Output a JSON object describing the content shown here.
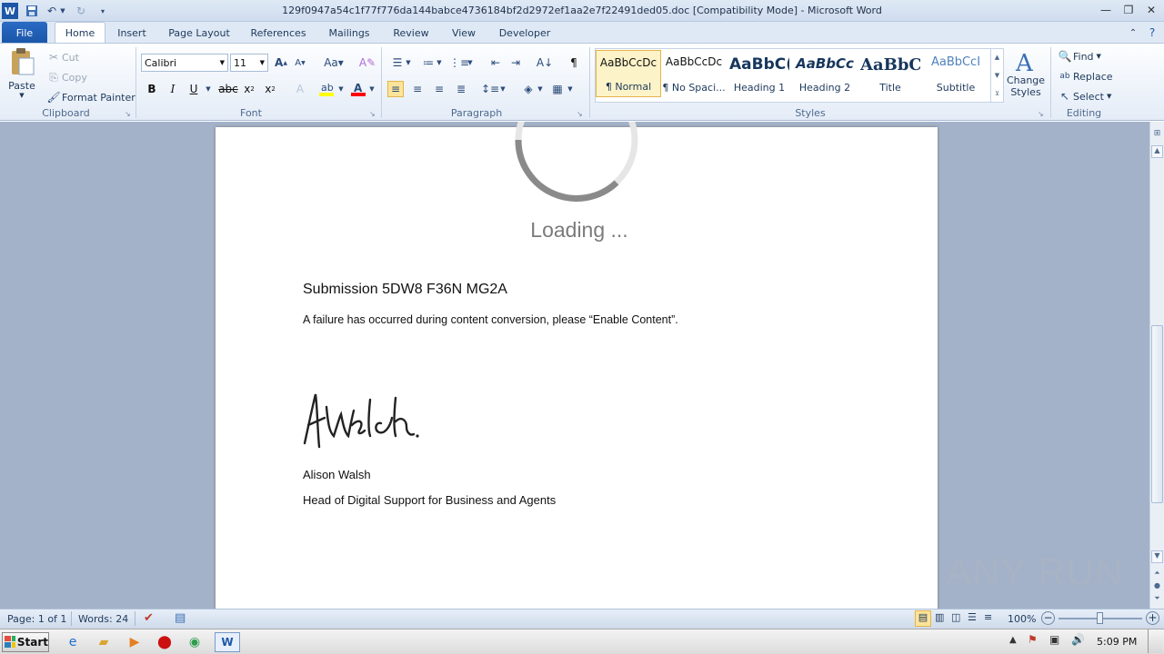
{
  "window": {
    "title": "129f0947a54c1f77f776da144babce4736184bf2d2972ef1aa2e7f22491ded05.doc [Compatibility Mode]  -  Microsoft Word"
  },
  "tabs": [
    "File",
    "Home",
    "Insert",
    "Page Layout",
    "References",
    "Mailings",
    "Review",
    "View",
    "Developer"
  ],
  "clipboard": {
    "paste": "Paste",
    "cut": "Cut",
    "copy": "Copy",
    "format_painter": "Format Painter",
    "label": "Clipboard"
  },
  "font": {
    "name": "Calibri",
    "size": "11",
    "label": "Font"
  },
  "paragraph": {
    "label": "Paragraph"
  },
  "styles": {
    "items": [
      {
        "preview": "AaBbCcDc",
        "label": "¶ Normal"
      },
      {
        "preview": "AaBbCcDc",
        "label": "¶ No Spaci..."
      },
      {
        "preview": "AaBbC(",
        "label": "Heading 1"
      },
      {
        "preview": "AaBbCc",
        "label": "Heading 2"
      },
      {
        "preview": "AaBbC(",
        "label": "Title"
      },
      {
        "preview": "AaBbCcI",
        "label": "Subtitle"
      }
    ],
    "change_styles": "Change Styles",
    "label": "Styles"
  },
  "editing": {
    "find": "Find",
    "replace": "Replace",
    "select": "Select",
    "label": "Editing"
  },
  "document": {
    "loading": "Loading ...",
    "heading": "Submission 5DW8 F36N MG2A",
    "body": "A failure has occurred during content conversion, please “Enable Content”.",
    "signature": "A Walsh.",
    "name": "Alison Walsh",
    "role": "Head of Digital Support for Business and Agents"
  },
  "status": {
    "page": "Page: 1 of 1",
    "words": "Words: 24",
    "zoom": "100%"
  },
  "watermark": "ANY RUN",
  "taskbar": {
    "start": "Start",
    "time": "5:09 PM"
  },
  "colors": {
    "file_tab": "#1a55a8",
    "doc_bg": "#a3b2c8",
    "highlight": "#ffff00",
    "font_color": "#ff0000"
  }
}
